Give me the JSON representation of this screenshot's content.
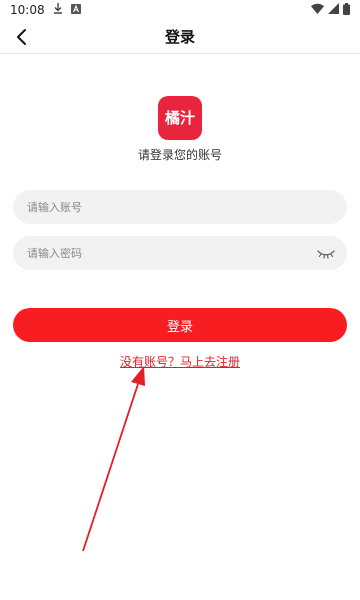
{
  "status_bar": {
    "time": "10:08"
  },
  "nav": {
    "title": "登录"
  },
  "logo": {
    "text": "橘汁"
  },
  "subtitle": "请登录您的账号",
  "account_field": {
    "placeholder": "请输入账号",
    "value": ""
  },
  "password_field": {
    "placeholder": "请输入密码",
    "value": ""
  },
  "login_button": {
    "label": "登录"
  },
  "register_link": {
    "label": "没有账号？马上去注册"
  },
  "colors": {
    "accent": "#f71d21",
    "logo_bg": "#e8253c",
    "link": "#e31e24",
    "input_bg": "#f2f2f2"
  },
  "icons": [
    "download-icon",
    "text-a-icon",
    "wifi-icon",
    "signal-icon",
    "battery-icon",
    "back-arrow-icon",
    "eye-closed-icon"
  ]
}
